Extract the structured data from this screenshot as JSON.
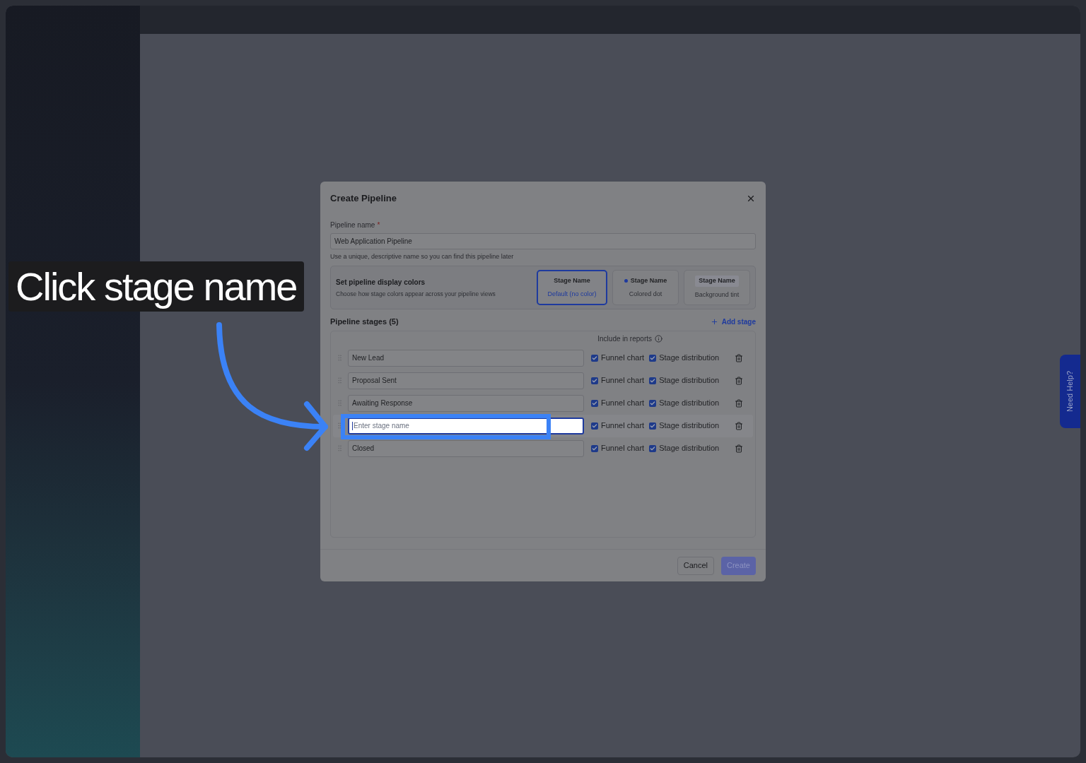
{
  "dialog": {
    "title": "Create Pipeline"
  },
  "pipeline_name": {
    "label": "Pipeline name",
    "required": true,
    "required_mark": "*",
    "value": "Web Application Pipeline",
    "hint": "Use a unique, descriptive name so you can find this pipeline later"
  },
  "display_colors": {
    "title": "Set pipeline display colors",
    "description": "Choose how stage colors appear across your pipeline views",
    "options": [
      {
        "kind": "plain",
        "name": "Stage Name",
        "caption": "Default (no color)",
        "selected": true
      },
      {
        "kind": "dot",
        "name": "Stage Name",
        "caption": "Colored dot",
        "selected": false
      },
      {
        "kind": "tint",
        "name": "Stage Name",
        "caption": "Background tint",
        "selected": false
      }
    ]
  },
  "stages": {
    "title": "Pipeline stages (5)",
    "add": "Add stage",
    "reports_label": "Include in reports",
    "rows": [
      {
        "value": "New Lead",
        "focused": false,
        "funnel": {
          "label": "Funnel chart",
          "checked": true
        },
        "distribution": {
          "label": "Stage distribution",
          "checked": true
        }
      },
      {
        "value": "Proposal Sent",
        "focused": false,
        "funnel": {
          "label": "Funnel chart",
          "checked": true
        },
        "distribution": {
          "label": "Stage distribution",
          "checked": true
        }
      },
      {
        "value": "Awaiting Response",
        "focused": false,
        "funnel": {
          "label": "Funnel chart",
          "checked": true
        },
        "distribution": {
          "label": "Stage distribution",
          "checked": true
        }
      },
      {
        "placeholder": "Enter stage name",
        "focused": true,
        "funnel": {
          "label": "Funnel chart",
          "checked": true
        },
        "distribution": {
          "label": "Stage distribution",
          "checked": true
        }
      },
      {
        "value": "Closed",
        "focused": false,
        "funnel": {
          "label": "Funnel chart",
          "checked": true
        },
        "distribution": {
          "label": "Stage distribution",
          "checked": true
        }
      }
    ]
  },
  "buttons": {
    "cancel": "Cancel",
    "create": {
      "label": "Create",
      "disabled": true
    }
  },
  "tutorial": {
    "caption": "Click stage name"
  },
  "help_tab": "Need Help?"
}
